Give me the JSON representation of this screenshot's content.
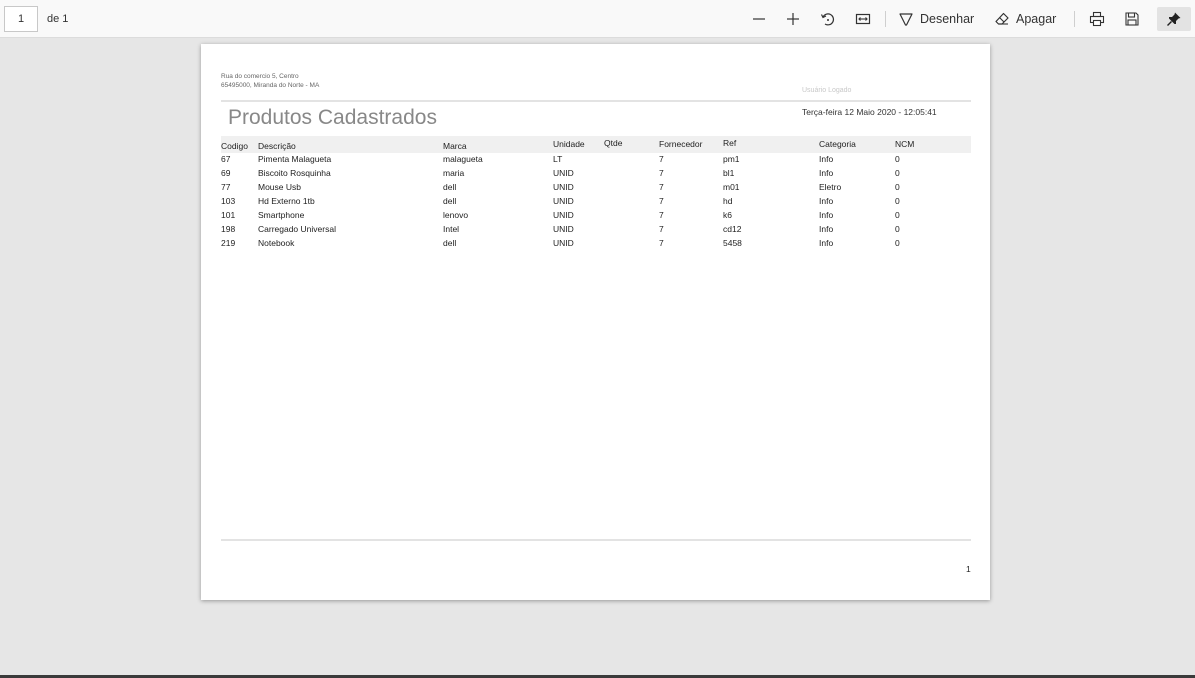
{
  "toolbar": {
    "page_value": "1",
    "page_of": "de 1",
    "draw_label": "Desenhar",
    "erase_label": "Apagar"
  },
  "report": {
    "address_line1": "Rua do comercio  5,  Centro",
    "address_line2": "65495000,  Miranda do Norte - MA",
    "user_label": "Usuário Logado",
    "title": "Produtos Cadastrados",
    "date": "Terça-feira 12 Maio 2020 - 12:05:41",
    "page_number": "1"
  },
  "table": {
    "headers": [
      "Codigo",
      "Descrição",
      "Marca",
      "Unidade",
      "Qtde",
      "Fornecedor",
      "Ref",
      "Categoria",
      "NCM"
    ],
    "rows": [
      [
        "67",
        "Pimenta Malagueta",
        "malagueta",
        "LT",
        "",
        "7",
        "pm1",
        "Info",
        "0"
      ],
      [
        "69",
        "Biscoito Rosquinha",
        "maria",
        "UNID",
        "",
        "7",
        "bl1",
        "Info",
        "0"
      ],
      [
        "77",
        "Mouse Usb",
        "dell",
        "UNID",
        "",
        "7",
        "m01",
        "Eletro",
        "0"
      ],
      [
        "103",
        "Hd Externo 1tb",
        "dell",
        "UNID",
        "",
        "7",
        "hd",
        "Info",
        "0"
      ],
      [
        "101",
        "Smartphone",
        "lenovo",
        "UNID",
        "",
        "7",
        "k6",
        "Info",
        "0"
      ],
      [
        "198",
        "Carregado Universal",
        "Intel",
        "UNID",
        "",
        "7",
        "cd12",
        "Info",
        "0"
      ],
      [
        "219",
        "Notebook",
        "dell",
        "UNID",
        "",
        "7",
        "5458",
        "Info",
        "0"
      ]
    ]
  },
  "icons": {
    "zoom_out": "minus-icon",
    "zoom_in": "plus-icon",
    "rotate": "rotate-icon",
    "fit": "fit-width-icon",
    "draw": "draw-icon",
    "erase": "eraser-icon",
    "print": "print-icon",
    "save": "save-icon",
    "pin": "pin-icon"
  }
}
